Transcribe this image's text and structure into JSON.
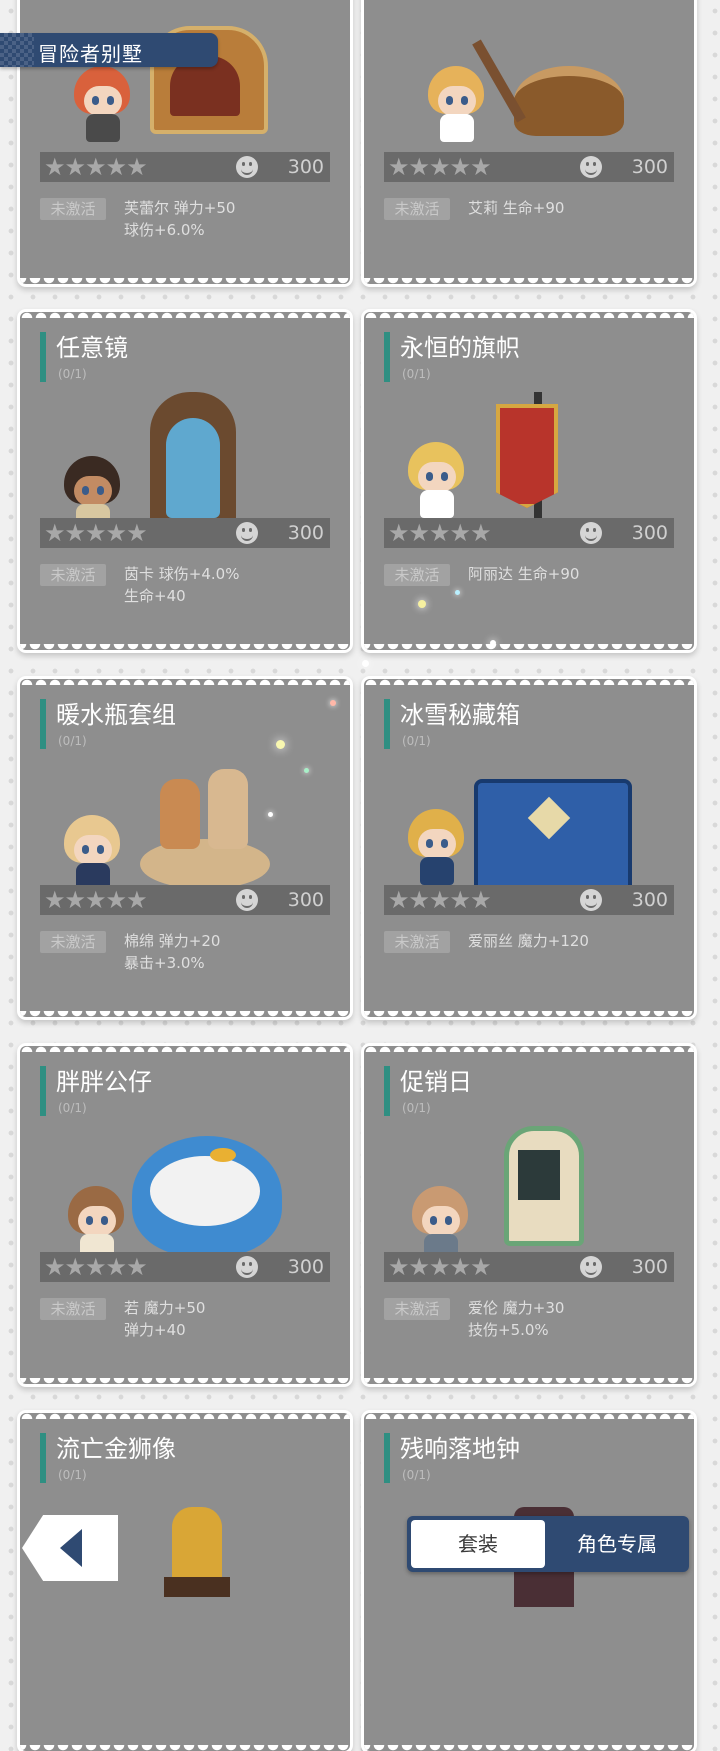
{
  "header": {
    "title": "冒险者别墅"
  },
  "labels": {
    "inactive": "未激活"
  },
  "cards": [
    {
      "title": "",
      "count": "",
      "score": "300",
      "stars": "★★★★★",
      "stats": [
        "芙蕾尔 弹力+50",
        "球伤+6.0%"
      ]
    },
    {
      "title": "",
      "count": "",
      "score": "300",
      "stars": "★★★★★",
      "stats": [
        "艾莉 生命+90"
      ]
    },
    {
      "title": "任意镜",
      "count": "(0/1)",
      "score": "300",
      "stars": "★★★★★",
      "stats": [
        "茵卡 球伤+4.0%",
        "生命+40"
      ]
    },
    {
      "title": "永恒的旗帜",
      "count": "(0/1)",
      "score": "300",
      "stars": "★★★★★",
      "stats": [
        "阿丽达 生命+90"
      ]
    },
    {
      "title": "暖水瓶套组",
      "count": "(0/1)",
      "score": "300",
      "stars": "★★★★★",
      "stats": [
        "棉绵 弹力+20",
        "暴击+3.0%"
      ]
    },
    {
      "title": "冰雪秘藏箱",
      "count": "(0/1)",
      "score": "300",
      "stars": "★★★★★",
      "stats": [
        "爱丽丝 魔力+120"
      ]
    },
    {
      "title": "胖胖公仔",
      "count": "(0/1)",
      "score": "300",
      "stars": "★★★★★",
      "stats": [
        "若 魔力+50",
        "弹力+40"
      ]
    },
    {
      "title": "促销日",
      "count": "(0/1)",
      "score": "300",
      "stars": "★★★★★",
      "stats": [
        "爱伦 魔力+30",
        "技伤+5.0%"
      ]
    },
    {
      "title": "流亡金狮像",
      "count": "(0/1)",
      "score": "",
      "stars": "",
      "stats": []
    },
    {
      "title": "残响落地钟",
      "count": "(0/1)",
      "score": "",
      "stars": "",
      "stats": []
    }
  ],
  "tabs": {
    "set": "套装",
    "role": "角色专属"
  },
  "icons": {
    "back": "back-arrow-icon",
    "score": "smiley-icon",
    "star": "star-icon"
  },
  "colors": {
    "accent": "#2f8f82",
    "navy": "#2f4a72",
    "card": "#8e8e8e"
  }
}
